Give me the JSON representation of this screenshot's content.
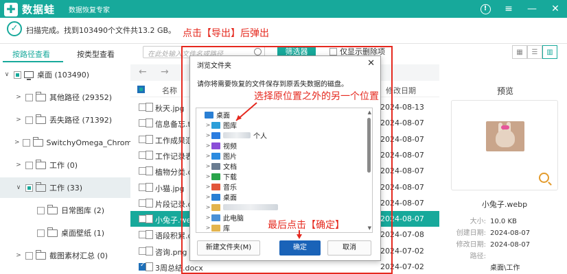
{
  "app": {
    "logo_text": "数据蛙",
    "subtitle": "数据恢复专家",
    "controls": {
      "help": "!",
      "menu": "≡",
      "minimize": "—",
      "close": "✕"
    }
  },
  "status": {
    "icon": "✓",
    "text": "扫描完成。找到103490个文件共13.2 GB。"
  },
  "tabs": {
    "path_view": "按路径查看",
    "type_view": "按类型查看"
  },
  "tree": [
    {
      "label": "桌面 (103490)",
      "level": 0,
      "expand": "∨",
      "kind": "drive",
      "state": "partial"
    },
    {
      "label": "其他路径 (29352)",
      "level": 1,
      "expand": ">",
      "kind": "folder",
      "state": "empty"
    },
    {
      "label": "丢失路径 (71392)",
      "level": 1,
      "expand": ">",
      "kind": "folder",
      "state": "empty"
    },
    {
      "label": "SwitchyOmega_Chromium",
      "level": 1,
      "expand": ">",
      "kind": "folder",
      "state": "empty"
    },
    {
      "label": "工作 (0)",
      "level": 1,
      "expand": ">",
      "kind": "folder",
      "state": "empty"
    },
    {
      "label": "工作 (33)",
      "level": 1,
      "expand": "∨",
      "kind": "folder",
      "state": "partial",
      "selected": true
    },
    {
      "label": "日常图库 (2)",
      "level": 2,
      "expand": "",
      "kind": "folder",
      "state": "empty"
    },
    {
      "label": "桌面壁纸 (1)",
      "level": 2,
      "expand": "",
      "kind": "folder",
      "state": "empty"
    },
    {
      "label": "截图素材汇总 (0)",
      "level": 1,
      "expand": ">",
      "kind": "folder",
      "state": "empty"
    }
  ],
  "toolbar": {
    "search_placeholder": "在此处输入文件名或路径",
    "filter_label": "筛选器",
    "only_deleted": "仅显示删除项"
  },
  "nav": {
    "back": "←",
    "forward": "→"
  },
  "list": {
    "col_name": "名称",
    "col_date": "修改日期",
    "rows": [
      {
        "name": "秋天.jpg",
        "date": "2024-08-13",
        "checked": false
      },
      {
        "name": "信息备忘.txt",
        "date": "2024-08-07",
        "checked": false
      },
      {
        "name": "工作成果汇总",
        "date": "2024-08-07",
        "checked": false
      },
      {
        "name": "工作记录表",
        "date": "2024-08-07",
        "checked": false
      },
      {
        "name": "植物分类.d",
        "date": "2024-08-07",
        "checked": false
      },
      {
        "name": "小猫.jpg",
        "date": "2024-08-07",
        "checked": false
      },
      {
        "name": "片段记录.d",
        "date": "2024-08-07",
        "checked": false
      },
      {
        "name": "小兔子.we",
        "date": "2024-08-07",
        "checked": false,
        "selected": true
      },
      {
        "name": "语段积累.d",
        "date": "2024-07-08",
        "checked": false
      },
      {
        "name": "咨询.png",
        "date": "2024-07-02",
        "checked": false
      },
      {
        "name": "3周总结.docx",
        "date": "2024-07-02",
        "checked": true
      }
    ]
  },
  "preview": {
    "title": "预览",
    "file_name": "小兔子.webp",
    "meta": [
      {
        "k": "大小:",
        "v": "10.0 KB"
      },
      {
        "k": "创建日期:",
        "v": "2024-08-07"
      },
      {
        "k": "修改日期:",
        "v": "2024-08-07"
      },
      {
        "k": "路径:",
        "v": ""
      },
      {
        "k": "",
        "v": "桌面\\工作"
      }
    ]
  },
  "dialog": {
    "title": "浏览文件夹",
    "close": "✕",
    "message": "请你将需要恢复的文件保存到原丢失数据的磁盘。",
    "tree": [
      {
        "label": "桌面",
        "expand": "",
        "color": "#2a7fd4",
        "indent": 0
      },
      {
        "label": "图库",
        "expand": ">",
        "color": "#2d9fd9",
        "indent": 1
      },
      {
        "label": "个人",
        "expand": ">",
        "color": "#2b7de0",
        "indent": 1,
        "blur": true
      },
      {
        "label": "视频",
        "expand": ">",
        "color": "#8b4ed8",
        "indent": 1
      },
      {
        "label": "图片",
        "expand": ">",
        "color": "#2b8be0",
        "indent": 1
      },
      {
        "label": "文档",
        "expand": ">",
        "color": "#6a7c90",
        "indent": 1
      },
      {
        "label": "下载",
        "expand": ">",
        "color": "#2aa54a",
        "indent": 1
      },
      {
        "label": "音乐",
        "expand": ">",
        "color": "#e2563a",
        "indent": 1
      },
      {
        "label": "桌面",
        "expand": ">",
        "color": "#2a7fd4",
        "indent": 1
      },
      {
        "label": "",
        "expand": ">",
        "color": "#e3b44d",
        "indent": 1,
        "blur": true
      },
      {
        "label": "此电脑",
        "expand": ">",
        "color": "#4a90d6",
        "indent": 1
      },
      {
        "label": "库",
        "expand": ">",
        "color": "#e3b44d",
        "indent": 1
      }
    ],
    "new_folder": "新建文件夹(M)",
    "ok": "确定",
    "cancel": "取消"
  },
  "annotations": {
    "top": "点击【导出】后弹出",
    "middle": "选择原位置之外的另一个位置",
    "bottom": "最后点击【确定】",
    "color": "#e5281e"
  }
}
